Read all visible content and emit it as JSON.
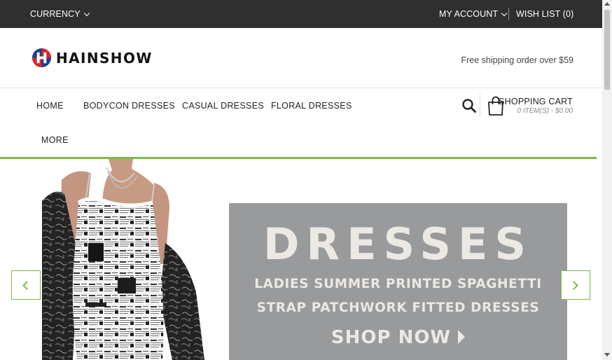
{
  "topbar": {
    "currency_label": "CURRENCY",
    "account_label": "MY ACCOUNT",
    "wishlist_label": "WISH LIST (0)"
  },
  "header": {
    "brand": "HAINSHOW",
    "shipping_note": "Free shipping order over $59"
  },
  "nav": {
    "items": [
      {
        "label": "HOME"
      },
      {
        "label": "BODYCON DRESSES"
      },
      {
        "label": "CASUAL DRESSES"
      },
      {
        "label": "FLORAL DRESSES"
      },
      {
        "label": "MORE"
      }
    ]
  },
  "cart": {
    "title": "SHOPPING CART",
    "summary": "0 ITEM(S) - $0.00"
  },
  "banner": {
    "headline": "DRESSES",
    "line1": "LADIES SUMMER PRINTED SPAGHETTI",
    "line2": "STRAP PATCHWORK FITTED DRESSES",
    "cta": "SHOP NOW"
  },
  "colors": {
    "topbar_bg": "#2f2f2f",
    "accent_green": "#7cbb47",
    "promo_bg": "#999a9c",
    "promo_text": "#ece8e3"
  },
  "icons": {
    "search": "search-icon",
    "cart": "shopping-bag-icon",
    "prev": "chevron-left-icon",
    "next": "chevron-right-icon"
  }
}
